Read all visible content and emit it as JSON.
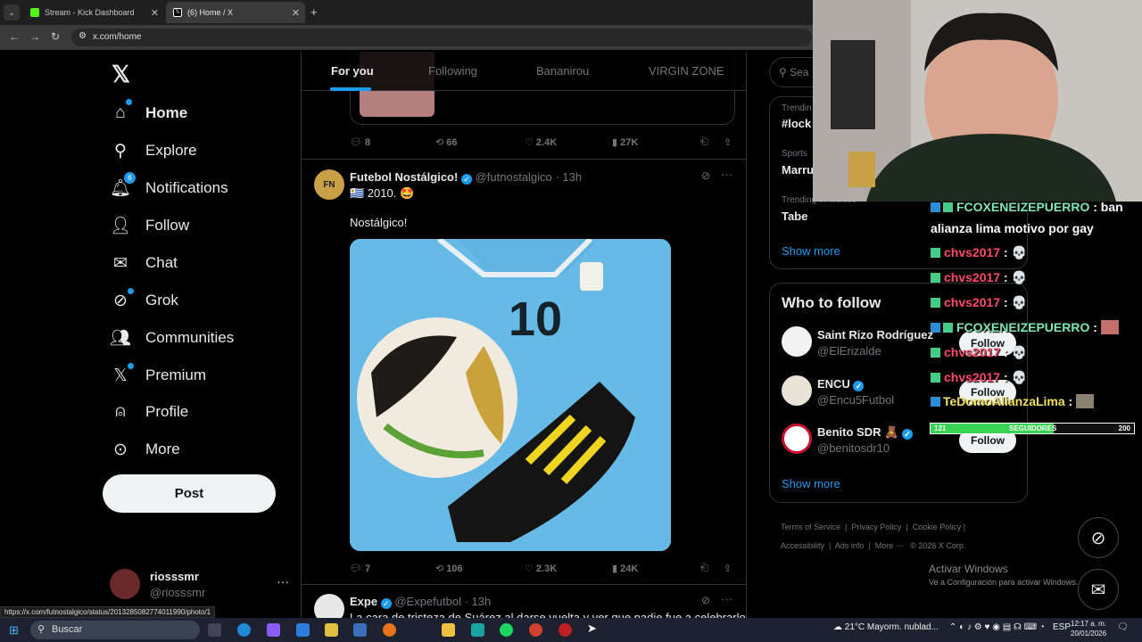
{
  "browser": {
    "tabs": [
      {
        "label": "Stream - Kick Dashboard"
      },
      {
        "label": "(6) Home / X"
      }
    ],
    "url": "x.com/home",
    "status_url": "https://x.com/futnostalgico/status/2013285082774011990/photo/1"
  },
  "nav": {
    "items": [
      {
        "label": "Home",
        "icon": "home-icon"
      },
      {
        "label": "Explore",
        "icon": "search-icon"
      },
      {
        "label": "Notifications",
        "icon": "bell-icon",
        "badge": "6"
      },
      {
        "label": "Follow",
        "icon": "person-plus-icon"
      },
      {
        "label": "Chat",
        "icon": "envelope-icon"
      },
      {
        "label": "Grok",
        "icon": "grok-icon"
      },
      {
        "label": "Communities",
        "icon": "people-icon"
      },
      {
        "label": "Premium",
        "icon": "x-logo-icon"
      },
      {
        "label": "Profile",
        "icon": "person-icon"
      },
      {
        "label": "More",
        "icon": "more-circle-icon"
      }
    ],
    "post_label": "Post",
    "account": {
      "name": "riosssmr",
      "handle": "@riosssmr"
    }
  },
  "timeline": {
    "tabs": [
      "For you",
      "Following",
      "Bananirou",
      "VIRGIN ZONE"
    ],
    "prev_actions": {
      "replies": "8",
      "reposts": "66",
      "likes": "2.4K",
      "views": "27K"
    },
    "tweet": {
      "name": "Futebol Nostálgico!",
      "handle": "@futnostalgico",
      "time": "· 13h",
      "line1": "🇺🇾 2010. 🤩",
      "line2": "Nostálgico!",
      "actions": {
        "replies": "7",
        "reposts": "106",
        "likes": "2.3K",
        "views": "24K"
      }
    },
    "next_tweet": {
      "name": "Expe",
      "handle": "@Expefutbol",
      "time": "· 13h",
      "text": "La cara de tristeza de Suárez al darse vuelta y ver que nadie fue a celebrarlo"
    }
  },
  "right": {
    "search_placeholder": "Sea",
    "trends": [
      {
        "sub": "Trendin",
        "title": "#lock"
      },
      {
        "sub": "Sports",
        "title": "Marru"
      },
      {
        "sub": "Trending in México",
        "title": "Tabe"
      }
    ],
    "show_more": "Show more",
    "who_to_follow": {
      "title": "Who to follow",
      "users": [
        {
          "name": "Saint Rizo Rodríguez",
          "handle": "@ElErizalde",
          "button": "Follow"
        },
        {
          "name": "ENCU",
          "handle": "@Encu5Futbol",
          "button": "Follow"
        },
        {
          "name": "Benito SDR 🧸",
          "handle": "@benitosdr10",
          "button": "Follow"
        }
      ],
      "show_more": "Show more"
    },
    "footer": {
      "links": [
        "Terms of Service",
        "Privacy Policy",
        "Cookie Policy",
        "Accessibility",
        "Ads info",
        "More ···"
      ],
      "copyright": "© 2026 X Corp."
    }
  },
  "stream_overlay": {
    "chat": [
      {
        "user": "FCOXENEIZEPUERRO",
        "msg": ": ban",
        "cont": "alianza lima motivo por gay",
        "badges": 2
      },
      {
        "user": "chvs2017",
        "msg": ": 💀"
      },
      {
        "user": "chvs2017",
        "msg": ": 💀"
      },
      {
        "user": "chvs2017",
        "msg": ": 💀"
      },
      {
        "user": "FCOXENEIZEPUERRO",
        "msg": ":",
        "badges": 2
      },
      {
        "user": "chvs2017",
        "msg": ": 💀"
      },
      {
        "user": "chvs2017",
        "msg": ": 💀"
      },
      {
        "user": "TeDomoAlianzaLima",
        "msg": ":",
        "badges": 1
      }
    ],
    "goal": {
      "current": "121",
      "label": "SEGUIDORES",
      "target": "200",
      "fraction": 0.605
    }
  },
  "windows": {
    "activate_title": "Activar Windows",
    "activate_sub": "Ve a Configuración para activar Windows.",
    "taskbar_search": "Buscar",
    "weather": "21°C  Mayorm. nublad...",
    "lang": "ESP",
    "time": "12:17 a. m.",
    "date": "20/01/2026"
  }
}
